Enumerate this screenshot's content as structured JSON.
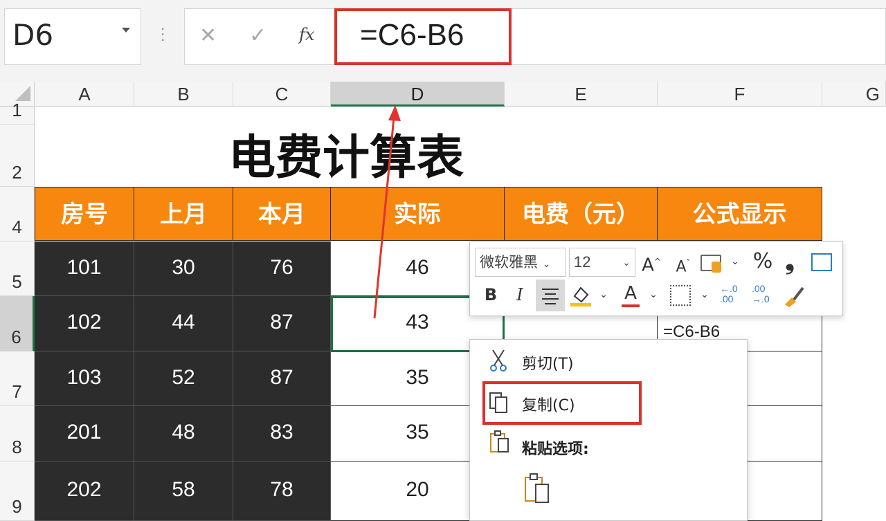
{
  "formula_bar": {
    "name_box": "D6",
    "cancel_icon": "✕",
    "enter_icon": "✓",
    "fx_label": "fx",
    "formula": "=C6-B6"
  },
  "columns": [
    "A",
    "B",
    "C",
    "D",
    "E",
    "F",
    "G"
  ],
  "selected_column": "D",
  "rows": [
    "1",
    "2",
    "4",
    "5",
    "6",
    "7",
    "8",
    "9"
  ],
  "selected_row": "6",
  "sheet": {
    "title": "电费计算表",
    "headers": [
      "房号",
      "上月",
      "本月",
      "实际",
      "电费（元）",
      "公式显示"
    ],
    "data": [
      [
        "101",
        "30",
        "76",
        "46"
      ],
      [
        "102",
        "44",
        "87",
        "43"
      ],
      [
        "103",
        "52",
        "87",
        "35"
      ],
      [
        "201",
        "48",
        "83",
        "35"
      ],
      [
        "202",
        "58",
        "78",
        "20"
      ]
    ],
    "formula_display_partial": "=C6-B6"
  },
  "mini_toolbar": {
    "font_name": "微软雅黑",
    "font_size": "12",
    "increase_font": "A",
    "decrease_font": "A",
    "percent": "%",
    "comma": "❟",
    "bold": "B",
    "italic": "I",
    "font_color": "A"
  },
  "context_menu": {
    "cut": "剪切(T)",
    "copy": "复制(C)",
    "paste_options": "粘贴选项:"
  },
  "colors": {
    "header_orange": "#f7870f",
    "dark_cell": "#2c2c2c",
    "highlight_red": "#d9312b",
    "selection_green": "#1e7145"
  }
}
